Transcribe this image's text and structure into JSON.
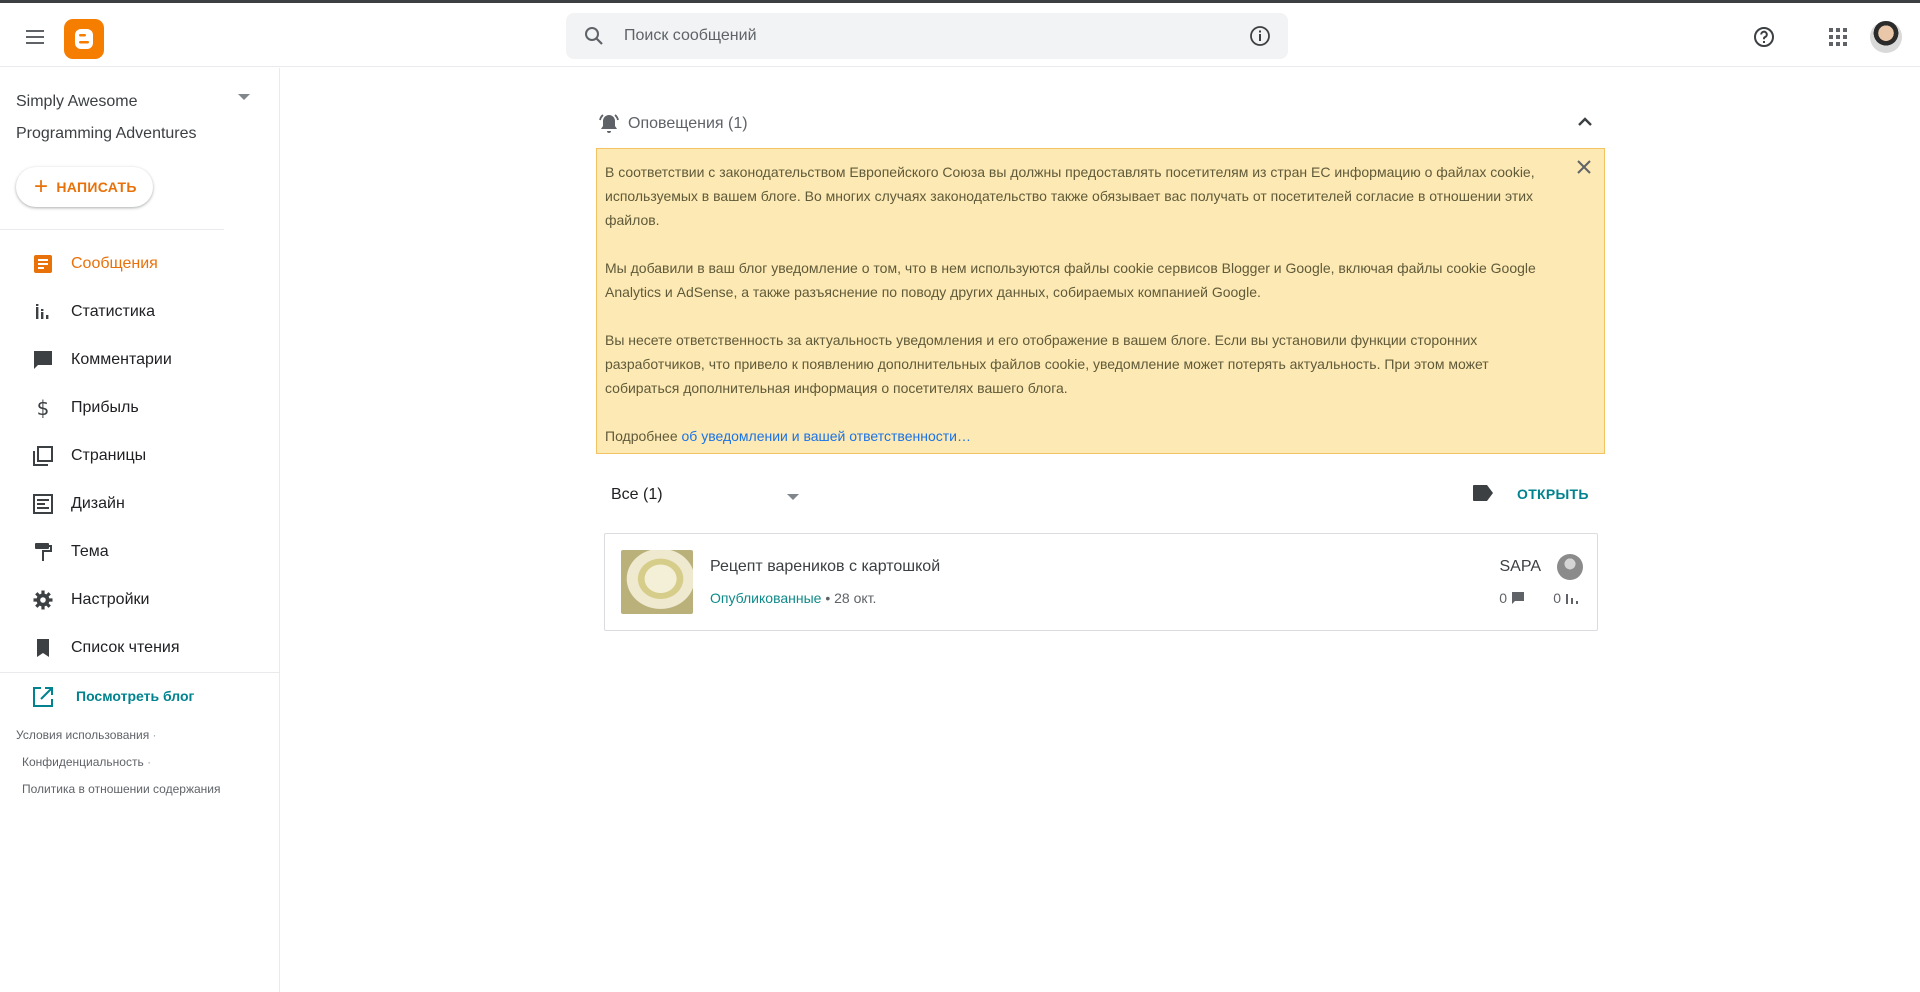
{
  "header": {
    "search_placeholder": "Поиск сообщений"
  },
  "sidebar": {
    "blog_name_line1": "Simply Awesome",
    "blog_name_line2": "Programming Adventures",
    "compose_label": "НАПИСАТЬ",
    "items": [
      {
        "label": "Сообщения",
        "icon": "posts-icon",
        "active": true
      },
      {
        "label": "Статистика",
        "icon": "stats-icon"
      },
      {
        "label": "Комментарии",
        "icon": "comments-icon"
      },
      {
        "label": "Прибыль",
        "icon": "earnings-icon"
      },
      {
        "label": "Страницы",
        "icon": "pages-icon"
      },
      {
        "label": "Дизайн",
        "icon": "layout-icon"
      },
      {
        "label": "Тема",
        "icon": "theme-icon"
      },
      {
        "label": "Настройки",
        "icon": "settings-icon"
      },
      {
        "label": "Список чтения",
        "icon": "bookmark-icon"
      }
    ],
    "view_blog_label": "Посмотреть блог",
    "footer": {
      "terms": "Условия использования",
      "privacy": "Конфиденциальность",
      "content_policy": "Политика в отношении содержания"
    }
  },
  "notifications": {
    "title": "Оповещения (1)",
    "p1": "В соответствии с законодательством Европейского Союза вы должны предоставлять посетителям из стран ЕС информацию о файлах cookie, используемых в вашем блоге. Во многих случаях законодательство также обязывает вас получать от посетителей согласие в отношении этих файлов.",
    "p2": "Мы добавили в ваш блог уведомление о том, что в нем используются файлы cookie сервисов Blogger и Google, включая файлы cookie Google Analytics и AdSense, а также разъяснение по поводу других данных, собираемых компанией Google.",
    "p3": "Вы несете ответственность за актуальность уведомления и его отображение в вашем блоге. Если вы установили функции сторонних разработчиков, что привело к появлению дополнительных файлов cookie, уведомление может потерять актуальность. При этом может собираться дополнительная информация о посетителях вашего блога.",
    "more_prefix": "Подробнее ",
    "more_link": "об уведомлении и вашей ответственности…"
  },
  "filter": {
    "label": "Все (1)"
  },
  "open_label": "ОТКРЫТЬ",
  "posts": [
    {
      "title": "Рецепт вареников с картошкой",
      "status": "Опубликованные",
      "separator": " • ",
      "date": "28 окт.",
      "author": "SAPA",
      "comments": "0",
      "views": "0"
    }
  ],
  "colors": {
    "brand": "#f57d00",
    "accent": "#e8710a",
    "link": "#00838f",
    "notice_bg": "#fde9b3"
  }
}
